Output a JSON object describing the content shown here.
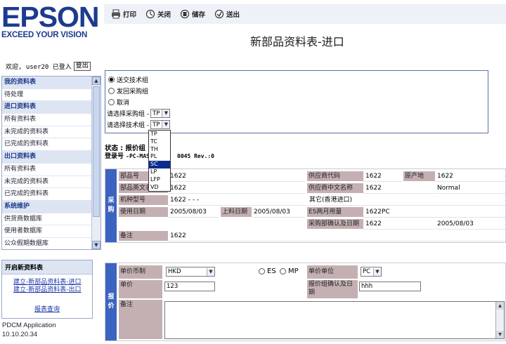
{
  "brand": {
    "name": "EPSON",
    "tagline": "EXCEED YOUR VISION",
    "color": "#1c3b8f"
  },
  "toolbar": {
    "print_label": "打印",
    "close_label": "关闭",
    "save_label": "储存",
    "send_label": "送出"
  },
  "page_title": "新部品资料表-进口",
  "user": {
    "welcome": "欢迎, user20 已登入",
    "logout_label": "登出"
  },
  "sidebar": {
    "items": [
      {
        "label": "我的资料表",
        "type": "head"
      },
      {
        "label": "待处理",
        "type": "item"
      },
      {
        "label": "进口资料表",
        "type": "head"
      },
      {
        "label": "所有资料表",
        "type": "item"
      },
      {
        "label": "未完成的资料表",
        "type": "item"
      },
      {
        "label": "已完成的资料表",
        "type": "item"
      },
      {
        "label": "出口资料表",
        "type": "head"
      },
      {
        "label": "所有资料表",
        "type": "item"
      },
      {
        "label": "未完成的资料表",
        "type": "item"
      },
      {
        "label": "已完成的资料表",
        "type": "item"
      },
      {
        "label": "系统维护",
        "type": "head"
      },
      {
        "label": "供货商数据库",
        "type": "item"
      },
      {
        "label": "使用者数据库",
        "type": "item"
      },
      {
        "label": "公众假期数据库",
        "type": "item"
      }
    ]
  },
  "new_forms": {
    "title": "开启新资料表",
    "link_import": "建立-新部品资料表-进口",
    "link_export": "建立-新部品资料表-出口",
    "report_link": "报表查询"
  },
  "app_info": {
    "name": "PDCM Application",
    "version": "10.10.20.34"
  },
  "routing": {
    "options": [
      "送交技术组",
      "发回采购组",
      "取消"
    ],
    "selected_index": 0,
    "purchase_group_label": "请选择采购组 -",
    "purchase_group_value": "TP",
    "tech_group_label": "请选择技术组 -",
    "tech_group_value": "TP",
    "dropdown_options": [
      "TP",
      "TC",
      "TH",
      "PL",
      "SC",
      "LP",
      "LFP",
      "VD"
    ],
    "dropdown_highlighted": "SC"
  },
  "status": {
    "label": "状态 : 报价组",
    "reg_label": "登录号",
    "reg_value": "-PC-MAS",
    "rev": "0045 Rev.:0"
  },
  "procurement": {
    "section_label": [
      "采",
      "购"
    ],
    "part_no_label": "部品号",
    "part_no": "1622",
    "part_en_label": "部品英文名",
    "part_en": "1622",
    "model_label": "机种型号",
    "model": "1622 - - -",
    "use_date_label": "使用日期",
    "use_date": "2005/08/03",
    "mat_date_label": "上料日期",
    "mat_date": "2005/08/03",
    "supplier_code_label": "供应商代码",
    "supplier_code": "1622",
    "origin_label": "原产地",
    "origin": "1622",
    "supplier_cn_label": "供应商中文名称",
    "supplier_cn": "1622",
    "supplier_cn_extra": "Normal",
    "other_note": "其它(香港进口)",
    "es_usage_label": "ES两月用量",
    "es_usage": "1622PC",
    "confirm_label": "采购部确认及日期",
    "confirm_value": "1622",
    "confirm_date": "2005/08/03",
    "remark_label": "备注",
    "remark": "1622"
  },
  "quotation": {
    "section_label": [
      "报",
      "价"
    ],
    "currency_label": "单价币制",
    "currency_value": "HKD",
    "radio_es": "ES",
    "radio_mp": "MP",
    "unit_label": "单价单位",
    "unit_value": "PC",
    "price_label": "单价",
    "price_value": "123",
    "confirm_label": "报价组确认及日期",
    "confirm_value": "hhh",
    "remark_label": "备注"
  }
}
